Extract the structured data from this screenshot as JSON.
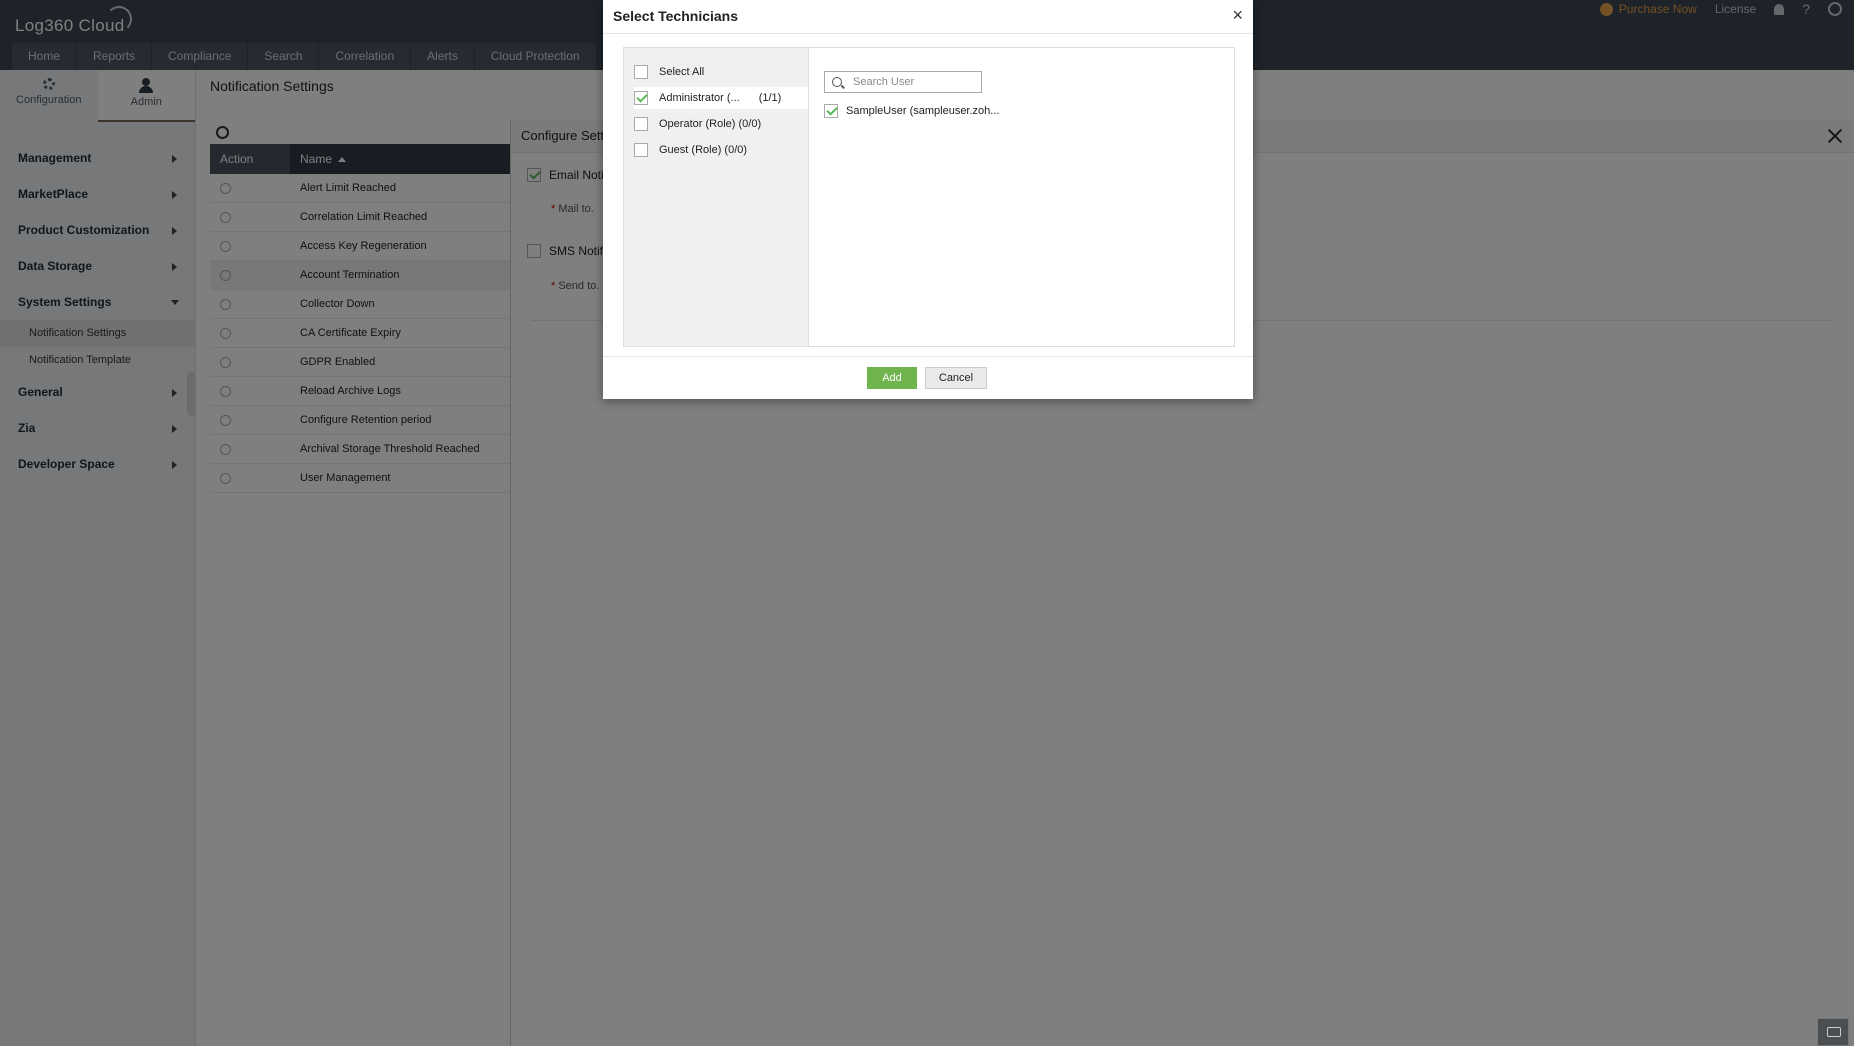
{
  "app": {
    "title": "Log360 Cloud"
  },
  "header": {
    "purchase_label": "Purchase Now",
    "license_label": "License",
    "help_label": "?"
  },
  "nav": {
    "tabs": [
      "Home",
      "Reports",
      "Compliance",
      "Search",
      "Correlation",
      "Alerts",
      "Cloud Protection"
    ]
  },
  "sidebar": {
    "tabs": [
      "Configuration",
      "Admin"
    ],
    "active_tab": "Admin",
    "items": [
      {
        "label": "Management"
      },
      {
        "label": "MarketPlace"
      },
      {
        "label": "Product Customization"
      },
      {
        "label": "Data Storage"
      },
      {
        "label": "System Settings",
        "expanded": true,
        "children": [
          {
            "label": "Notification Settings",
            "active": true
          },
          {
            "label": "Notification Template"
          }
        ]
      },
      {
        "label": "General"
      },
      {
        "label": "Zia"
      },
      {
        "label": "Developer Space"
      }
    ]
  },
  "page": {
    "title": "Notification Settings"
  },
  "table": {
    "columns": [
      "Action",
      "Name"
    ],
    "rows": [
      "Alert Limit Reached",
      "Correlation Limit Reached",
      "Access Key Regeneration",
      "Account Termination",
      "Collector Down",
      "CA Certificate Expiry",
      "GDPR Enabled",
      "Reload Archive Logs",
      "Configure Retention period",
      "Archival Storage Threshold Reached",
      "User Management"
    ],
    "highlighted_row": "Account Termination"
  },
  "config_panel": {
    "title": "Configure Setti",
    "email_label": "Email Notifi",
    "email_checked": true,
    "mail_to_label": "Mail to.",
    "sms_label": "SMS Notifi",
    "sms_checked": false,
    "send_to_label": "Send to."
  },
  "modal": {
    "title": "Select Technicians",
    "close_label": "×",
    "roles": [
      {
        "label": "Select All",
        "count": "",
        "checked": false
      },
      {
        "label": "Administrator (...",
        "count": "(1/1)",
        "checked": true
      },
      {
        "label": "Operator (Role)",
        "count": "(0/0)",
        "checked": false
      },
      {
        "label": "Guest (Role)",
        "count": "(0/0)",
        "checked": false
      }
    ],
    "search_placeholder": "Search User",
    "users": [
      {
        "label": "SampleUser (sampleuser.zoh...",
        "checked": true
      }
    ],
    "add_label": "Add",
    "cancel_label": "Cancel"
  },
  "colors": {
    "topbar": "#3b4650",
    "accent_green": "#6fb44d",
    "purchase": "#e7a24b",
    "table_header": "#2f3a44"
  }
}
